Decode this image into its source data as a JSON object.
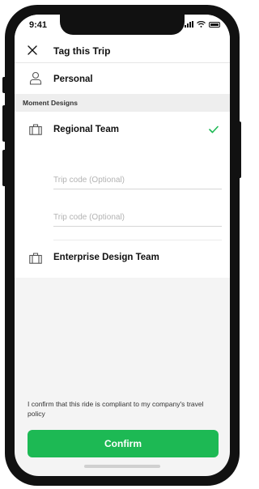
{
  "status_bar": {
    "time": "9:41"
  },
  "header": {
    "title": "Tag this Trip",
    "close_icon": "close-icon"
  },
  "personal": {
    "label": "Personal",
    "icon": "person-icon"
  },
  "section": {
    "label": "Moment Designs"
  },
  "organizations": [
    {
      "name": "Regional Team",
      "icon": "briefcase-icon",
      "selected": true,
      "trip_fields": [
        {
          "placeholder": "Trip code (Optional)",
          "value": ""
        },
        {
          "placeholder": "Trip code (Optional)",
          "value": ""
        }
      ]
    },
    {
      "name": "Enterprise Design Team",
      "icon": "briefcase-icon",
      "selected": false
    }
  ],
  "compliance_text": "I confirm that this ride is compliant to my company's travel policy",
  "confirm_button": {
    "label": "Confirm"
  },
  "colors": {
    "accent": "#1db954",
    "section_bg": "#eeeeee",
    "screen_bg": "#f4f4f4"
  }
}
